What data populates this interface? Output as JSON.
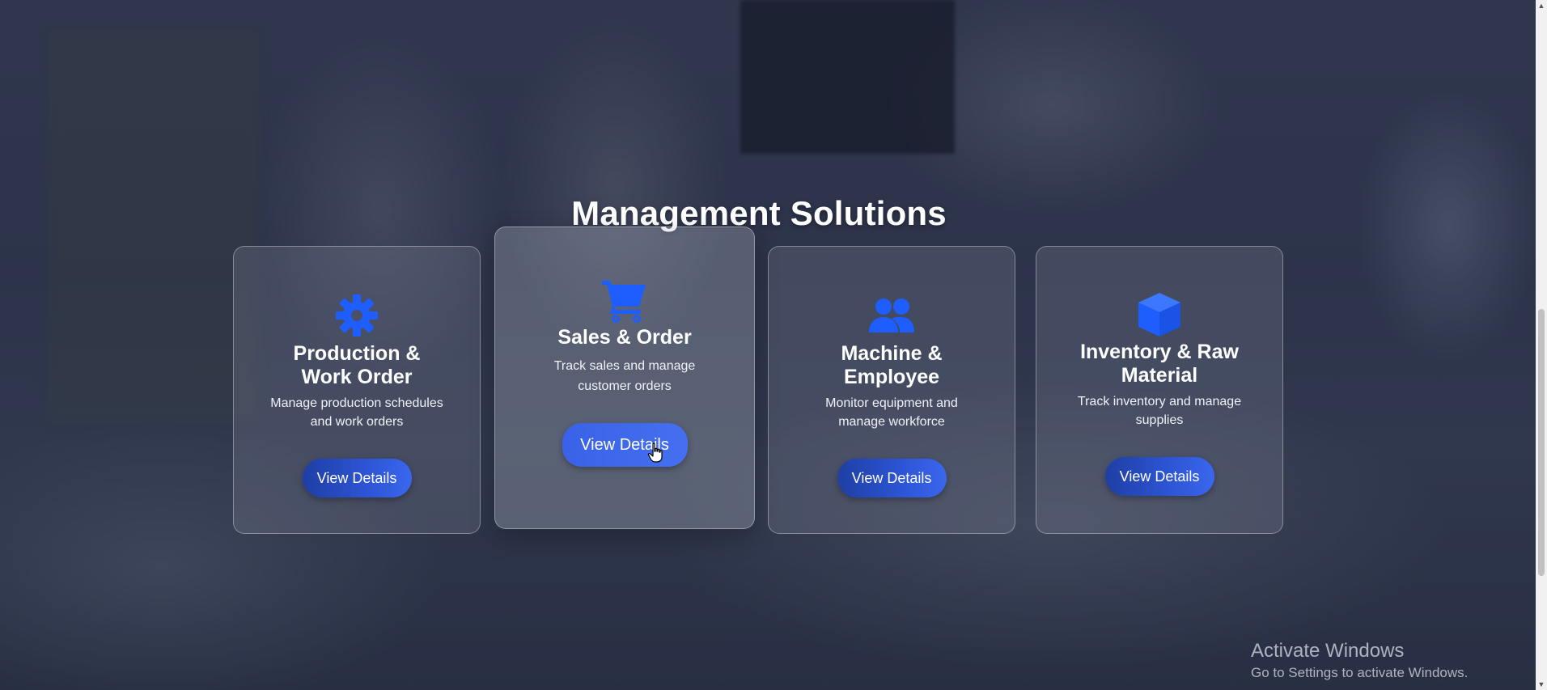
{
  "section": {
    "title": "Management Solutions"
  },
  "cards": [
    {
      "icon": "gear-icon",
      "title_line1": "Production &",
      "title_line2": "Work Order",
      "desc_line1": "Manage production schedules",
      "desc_line2": "and work orders",
      "button": "View Details"
    },
    {
      "icon": "shopping-cart-icon",
      "title_line1": "Sales & Order",
      "desc_line1": "Track sales and manage",
      "desc_line2": "customer orders",
      "button": "View Details"
    },
    {
      "icon": "users-icon",
      "title_line1": "Machine &",
      "title_line2": "Employee",
      "desc_line1": "Monitor equipment and",
      "desc_line2": "manage workforce",
      "button": "View Details"
    },
    {
      "icon": "cube-icon",
      "title_line1": "Inventory & Raw",
      "title_line2": "Material",
      "desc_line1": "Track inventory and manage",
      "desc_line2": "supplies",
      "button": "View Details"
    }
  ],
  "watermark": {
    "line1": "Activate Windows",
    "line2": "Go to Settings to activate Windows."
  },
  "colors": {
    "accent_icon": "#1e5eff",
    "button_start": "#1f3fa5",
    "button_end": "#3a67ee"
  }
}
